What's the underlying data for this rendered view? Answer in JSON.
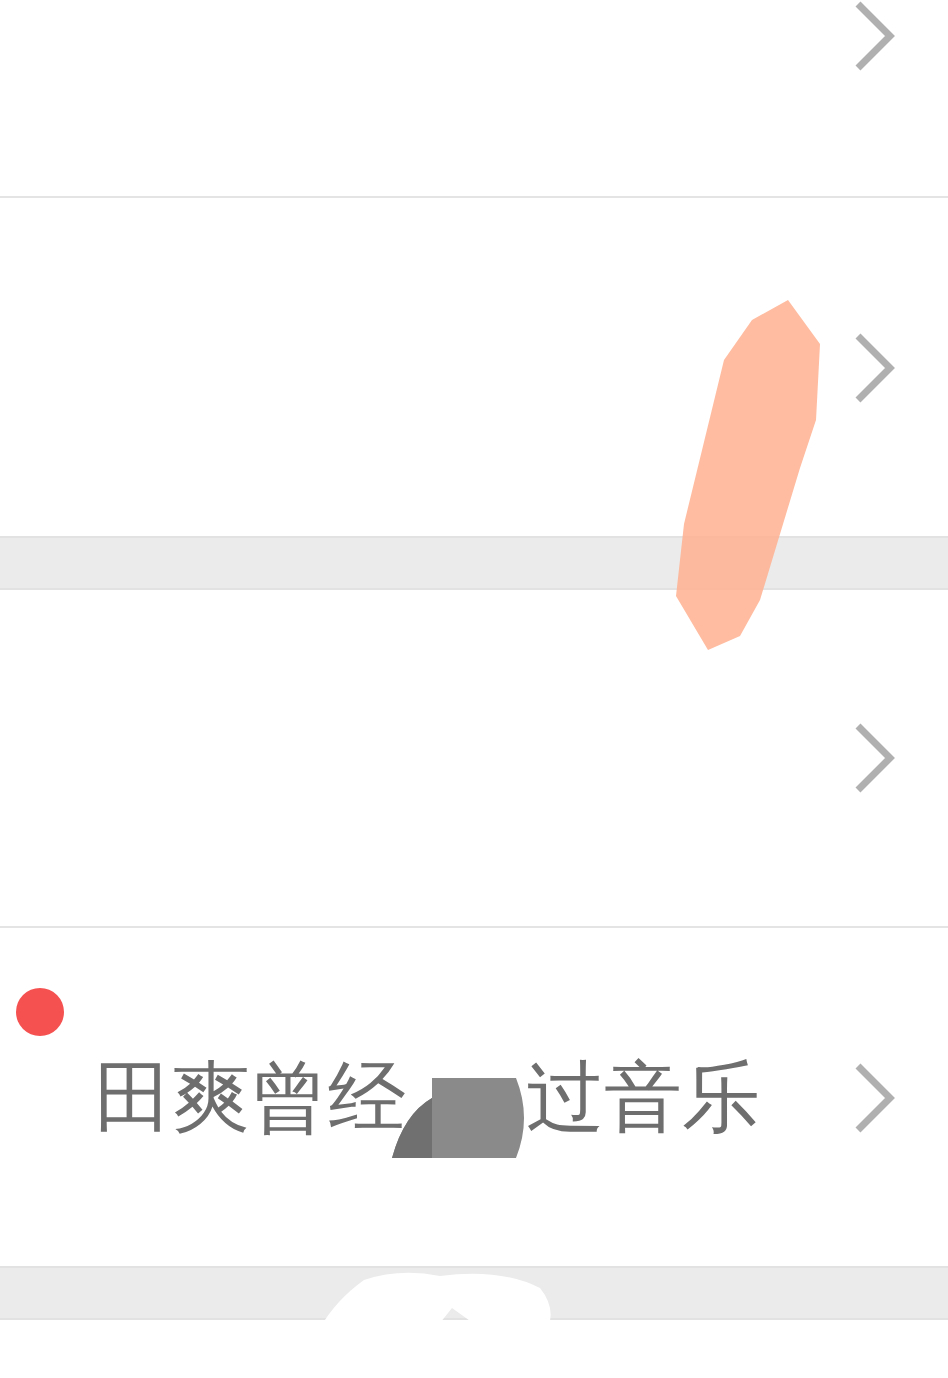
{
  "sections": [
    {
      "rows": [
        {
          "kind": "blank"
        },
        {
          "kind": "blank"
        }
      ]
    },
    {
      "rows": [
        {
          "kind": "blank"
        },
        {
          "kind": "titled",
          "unread": true,
          "title_parts": [
            "田爽曾经",
            "过音乐"
          ]
        }
      ]
    }
  ]
}
